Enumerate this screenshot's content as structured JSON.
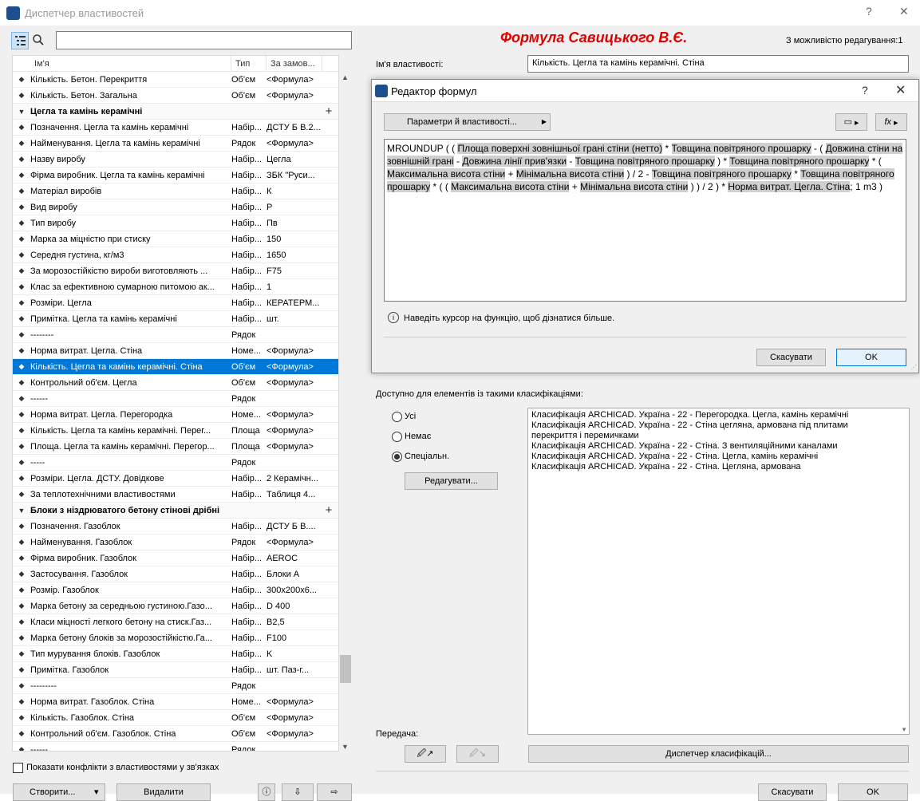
{
  "window": {
    "title": "Диспетчер властивостей",
    "help": "?",
    "close": "✕"
  },
  "list": {
    "columns": [
      "Ім'я",
      "Тип",
      "За замов..."
    ],
    "rows": [
      {
        "n": "Кількість. Бетон. Перекриття",
        "t": "Об'єм",
        "v": "<Формула>"
      },
      {
        "n": "Кількість. Бетон. Загальна",
        "t": "Об'єм",
        "v": "<Формула>"
      },
      {
        "group": "Цегла та камінь керамічні"
      },
      {
        "n": "Позначення. Цегла та камінь керамічні",
        "t": "Набір...",
        "v": "ДСТУ Б В.2..."
      },
      {
        "n": "Найменування. Цегла та камінь керамічні",
        "t": "Рядок",
        "v": "<Формула>"
      },
      {
        "n": "Назву виробу",
        "t": "Набір...",
        "v": "Цегла"
      },
      {
        "n": "Фірма виробник. Цегла та камінь керамічні",
        "t": "Набір...",
        "v": "ЗБК \"Руси..."
      },
      {
        "n": "Матеріал виробів",
        "t": "Набір...",
        "v": "К"
      },
      {
        "n": "Вид виробу",
        "t": "Набір...",
        "v": "Р"
      },
      {
        "n": "Тип виробу",
        "t": "Набір...",
        "v": "Пв"
      },
      {
        "n": "Марка за міцністю при стиску",
        "t": "Набір...",
        "v": "150"
      },
      {
        "n": "Середня густина, кг/м3",
        "t": "Набір...",
        "v": "1650"
      },
      {
        "n": "За морозостійкістю вироби виготовляють ...",
        "t": "Набір...",
        "v": "F75"
      },
      {
        "n": "Клас за ефективною сумарною питомою ак...",
        "t": "Набір...",
        "v": "1"
      },
      {
        "n": "Розміри. Цегла",
        "t": "Набір...",
        "v": "КЕРАТЕРМ..."
      },
      {
        "n": "Примітка.  Цегла та камінь керамічні",
        "t": "Набір...",
        "v": "шт."
      },
      {
        "n": "--------",
        "t": "Рядок",
        "v": ""
      },
      {
        "n": "Норма витрат. Цегла. Стіна",
        "t": "Номе...",
        "v": "<Формула>"
      },
      {
        "n": "Кількість. Цегла та камінь керамічні. Стіна",
        "t": "Об'єм",
        "v": "<Формула>",
        "selected": true
      },
      {
        "n": "Контрольний об'єм. Цегла",
        "t": "Об'єм",
        "v": "<Формула>"
      },
      {
        "n": "------",
        "t": "Рядок",
        "v": ""
      },
      {
        "n": "Норма витрат. Цегла. Перегородка",
        "t": "Номе...",
        "v": "<Формула>"
      },
      {
        "n": "Кількість. Цегла та камінь керамічні. Перег...",
        "t": "Площа",
        "v": "<Формула>"
      },
      {
        "n": "Площа. Цегла та камінь керамічні. Перегор...",
        "t": "Площа",
        "v": "<Формула>"
      },
      {
        "n": "-----",
        "t": "Рядок",
        "v": ""
      },
      {
        "n": "Розміри. Цегла. ДСТУ. Довідкове",
        "t": "Набір...",
        "v": "2 Керамічн..."
      },
      {
        "n": "За теплотехнічними властивостями",
        "t": "Набір...",
        "v": "Таблиця 4..."
      },
      {
        "group": "Блоки з ніздрюватого бетону стінові дрібні"
      },
      {
        "n": "Позначення. Газоблок",
        "t": "Набір...",
        "v": " ДСТУ Б В...."
      },
      {
        "n": "Найменування. Газоблок",
        "t": "Рядок",
        "v": "<Формула>"
      },
      {
        "n": "Фірма виробник. Газоблок",
        "t": "Набір...",
        "v": "AEROC"
      },
      {
        "n": "Застосування. Газоблок",
        "t": "Набір...",
        "v": "Блоки А"
      },
      {
        "n": "Розмір. Газоблок",
        "t": "Набір...",
        "v": "300x200x6..."
      },
      {
        "n": "Марка бетону за середньою густиною.Газо...",
        "t": "Набір...",
        "v": "D 400"
      },
      {
        "n": "Класи міцності легкого бетону на стиск.Газ...",
        "t": "Набір...",
        "v": "B2,5"
      },
      {
        "n": "Марка бетону блоків за морозостійкістю.Га...",
        "t": "Набір...",
        "v": "F100"
      },
      {
        "n": "Тип мурування блоків. Газоблок",
        "t": "Набір...",
        "v": "K"
      },
      {
        "n": "Примітка.  Газоблок",
        "t": "Набір...",
        "v": "шт. Паз-г..."
      },
      {
        "n": "---------",
        "t": "Рядок",
        "v": ""
      },
      {
        "n": "Норма витрат. Газоблок. Стіна",
        "t": "Номе...",
        "v": "<Формула>"
      },
      {
        "n": "Кількість. Газоблок. Стіна",
        "t": "Об'єм",
        "v": "<Формула>"
      },
      {
        "n": "Контрольний об'єм.  Газоблок. Стіна",
        "t": "Об'єм",
        "v": "<Формула>"
      },
      {
        "n": "------",
        "t": "Рядок",
        "v": ""
      }
    ]
  },
  "left_bottom": {
    "conflicts_label": "Показати конфлікти з властивостями у зв'язках",
    "create": "Створити...",
    "delete": "Видалити"
  },
  "right": {
    "title": "Формула Савицького В.Є.",
    "edit_status": "З можливістю редагування:1",
    "name_label": "Ім'я властивості:",
    "name_value": "Кількість. Цегла та камінь керамічні. Стіна",
    "avail_label": "Доступно для елементів із такими класифікаціями:",
    "radio_all": "Усі",
    "radio_none": "Немає",
    "radio_special": "Спеціальн.",
    "edit_button": "Редагувати...",
    "classifications": [
      "Класифікація ARCHICAD. Україна - 22 - Перегородка. Цегла, камінь керамічні",
      "Класифікація ARCHICAD. Україна - 22 - Стіна цегляна, армована під плитами",
      "перекриття і перемичками",
      "Класифікація ARCHICAD. Україна - 22 - Стіна. З вентиляційними каналами",
      "Класифікація ARCHICAD. Україна - 22 - Стіна. Цегла, камінь керамічні",
      "Класифікація ARCHICAD. Україна - 22 - Стіна. Цегляна, армована"
    ],
    "transfer_label": "Передача:",
    "class_manager": "Диспетчер класифікацій...",
    "cancel": "Скасувати",
    "ok": "OK"
  },
  "dialog": {
    "title": "Редактор формул",
    "help": "?",
    "close": "✕",
    "params_button": "Параметри й властивості...",
    "formula": [
      {
        "t": "MROUNDUP ( ( ",
        "h": false
      },
      {
        "t": "Площа поверхні зовнішньої грані стіни (нетто)",
        "h": true
      },
      {
        "t": " * ",
        "h": false
      },
      {
        "t": "Товщина повітряного прошарку",
        "h": true
      },
      {
        "t": " - ( ",
        "h": false
      },
      {
        "t": "Довжина стіни на зовнішній грані",
        "h": true
      },
      {
        "t": " - ",
        "h": false
      },
      {
        "t": "Довжина лінії прив'язки",
        "h": true
      },
      {
        "t": " - ",
        "h": false
      },
      {
        "t": "Товщина повітряного прошарку",
        "h": true
      },
      {
        "t": " ) * ",
        "h": false
      },
      {
        "t": "Товщина повітряного прошарку",
        "h": true
      },
      {
        "t": " * ( ",
        "h": false
      },
      {
        "t": "Максимальна висота стіни",
        "h": true
      },
      {
        "t": " + ",
        "h": false
      },
      {
        "t": "Мінімальна висота стіни",
        "h": true
      },
      {
        "t": " ) / 2 - ",
        "h": false
      },
      {
        "t": "Товщина повітряного прошарку",
        "h": true
      },
      {
        "t": " * ",
        "h": false
      },
      {
        "t": "Товщина повітряного прошарку",
        "h": true
      },
      {
        "t": " * ( ( ",
        "h": false
      },
      {
        "t": "Максимальна висота стіни",
        "h": true
      },
      {
        "t": " + ",
        "h": false
      },
      {
        "t": "Мінімальна висота стіни",
        "h": true
      },
      {
        "t": " ) ) / 2 ) * ",
        "h": false
      },
      {
        "t": "Норма витрат. Цегла. Стіна",
        "h": true
      },
      {
        "t": "; 1 m3 )",
        "h": false
      }
    ],
    "hint": "Наведіть курсор на функцію, щоб дізнатися більше.",
    "cancel": "Скасувати",
    "ok": "OK"
  }
}
